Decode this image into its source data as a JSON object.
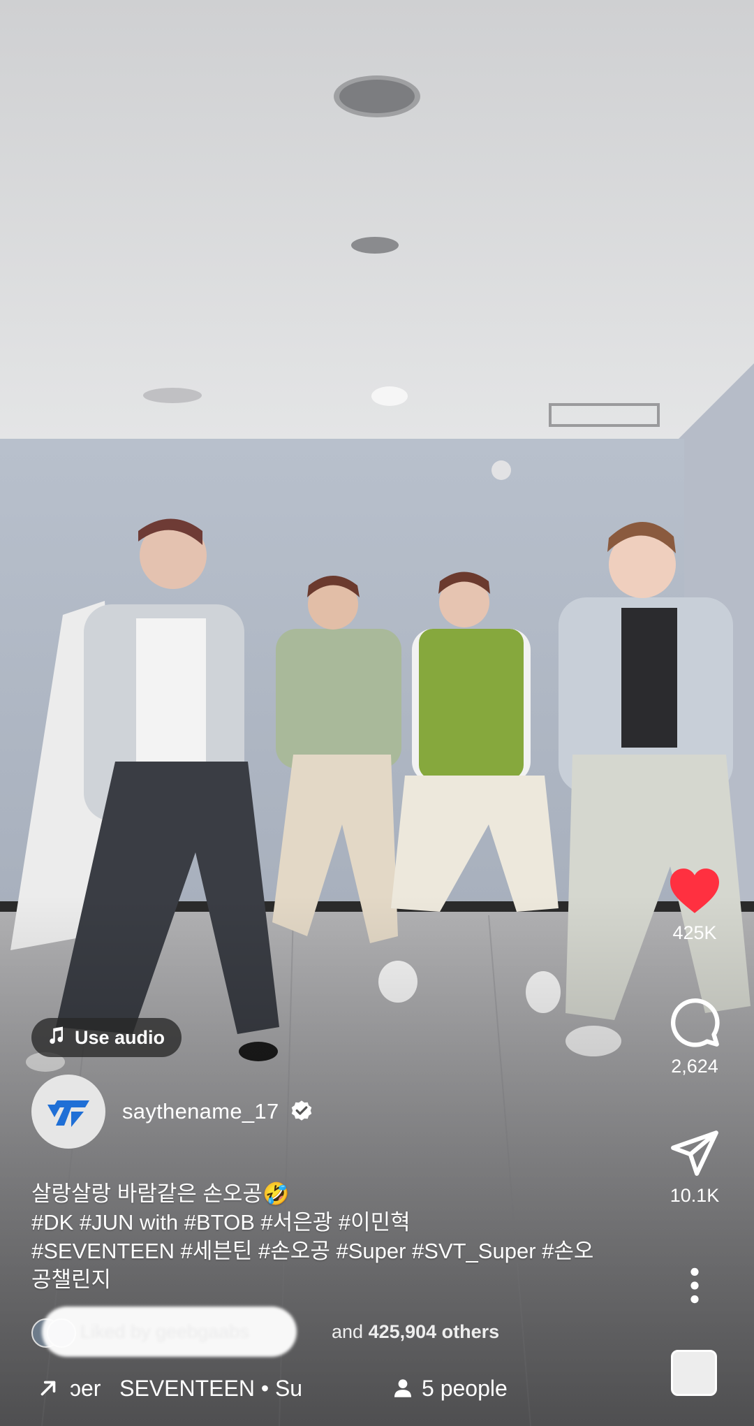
{
  "audio_button": {
    "label": "Use audio",
    "icon": "music-note-icon"
  },
  "author": {
    "username": "saythename_17",
    "verified": true
  },
  "caption": {
    "line1": "살랑살랑 바람같은 손오공🤣",
    "line2": "#DK #JUN with #BTOB #서은광 #이민혁",
    "line3": "#SEVENTEEN #세븐틴 #손오공 #Super #SVT_Super #손오",
    "line4": "공챌린지"
  },
  "likes": {
    "prefix": "Liked by geebgaabs",
    "and": "and",
    "count": "425,904 others"
  },
  "bottom": {
    "audio_text": "ɔer   SEVENTEEN • Su",
    "people": "5 people"
  },
  "actions": {
    "likes": "425K",
    "comments": "2,624",
    "shares": "10.1K"
  },
  "colors": {
    "heart": "#ff3040",
    "text": "#ffffff",
    "accent": "#1f6fd6"
  }
}
